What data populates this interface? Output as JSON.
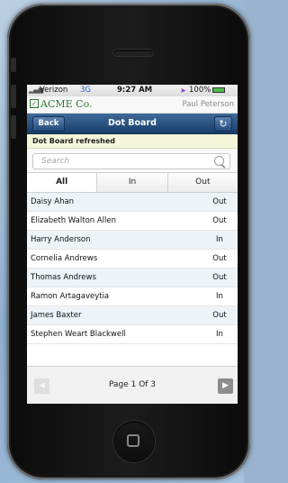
{
  "status_bar": {
    "signal": "▂▄▆",
    "carrier": "Verizon",
    "network": "3G",
    "time": "9:27 AM",
    "location": "➤",
    "battery": "100%"
  },
  "brand": {
    "logo_text": "ACME Co.",
    "user_name": "Paul Peterson"
  },
  "navbar": {
    "back_label": "Back",
    "title": "Dot Board",
    "refresh_icon": "↻"
  },
  "notice": "Dot Board refreshed",
  "search": {
    "placeholder": "Search"
  },
  "tabs": [
    {
      "label": "All",
      "active": true
    },
    {
      "label": "In",
      "active": false
    },
    {
      "label": "Out",
      "active": false
    }
  ],
  "people": [
    {
      "name": "Daisy Ahan",
      "status": "Out"
    },
    {
      "name": "Elizabeth Walton Allen",
      "status": "Out"
    },
    {
      "name": "Harry Anderson",
      "status": "In"
    },
    {
      "name": "Cornelia Andrews",
      "status": "Out"
    },
    {
      "name": "Thomas Andrews",
      "status": "Out"
    },
    {
      "name": "Ramon Artagaveytia",
      "status": "In"
    },
    {
      "name": "James Baxter",
      "status": "Out"
    },
    {
      "name": "Stephen Weart Blackwell",
      "status": "In"
    }
  ],
  "pager": {
    "label": "Page 1 Of 3",
    "prev_icon": "◀",
    "next_icon": "▶"
  },
  "colors": {
    "accent": "#1f4574",
    "brand_green": "#2e7d32"
  }
}
